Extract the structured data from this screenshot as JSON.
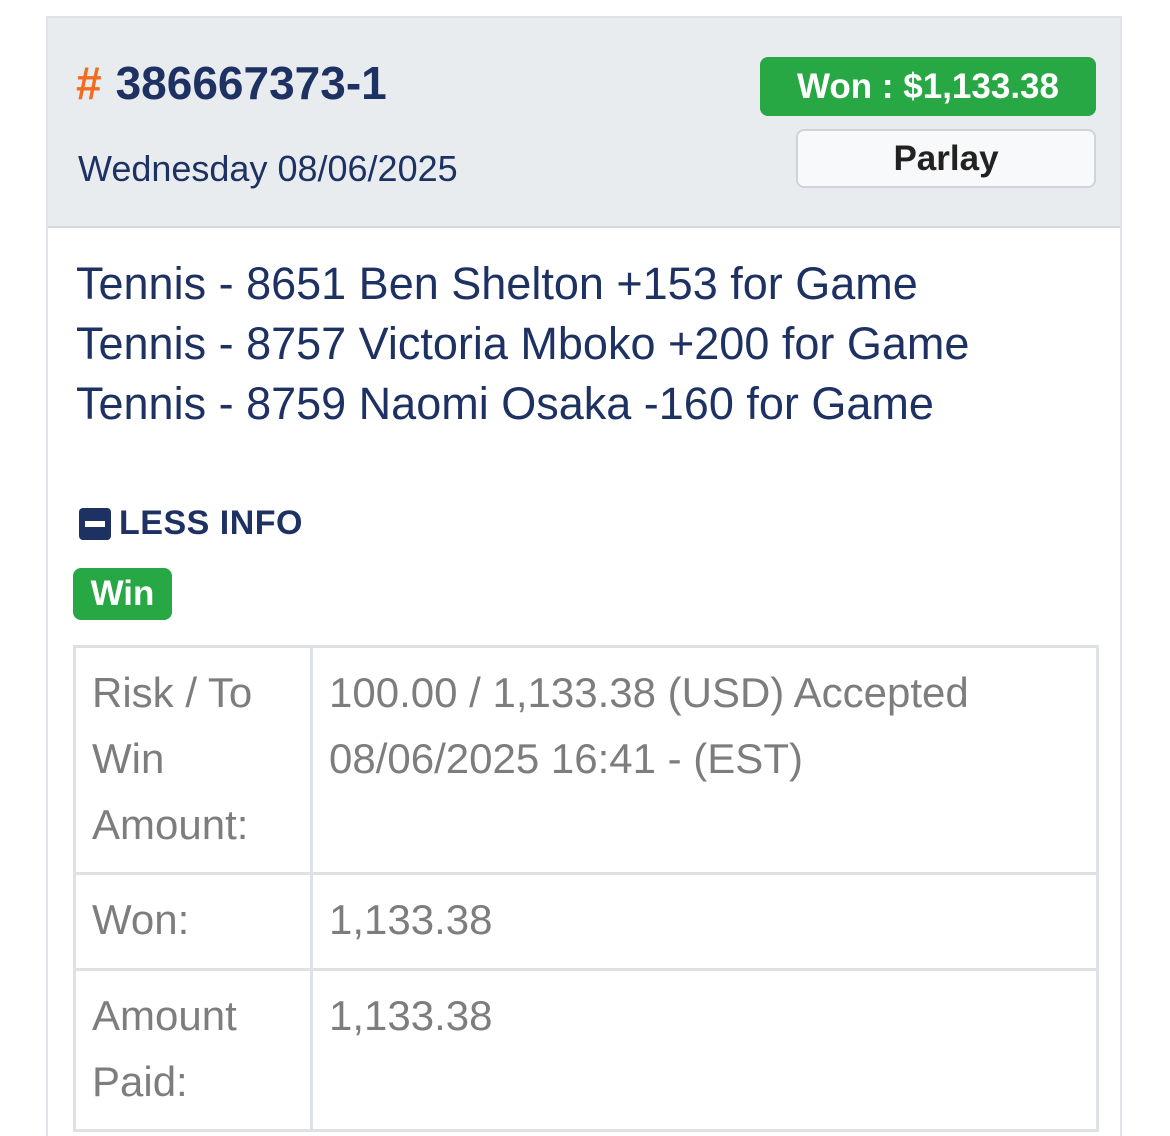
{
  "ticket": {
    "hash_symbol": "#",
    "number": "386667373-1",
    "date": "Wednesday 08/06/2025"
  },
  "status_badge": "Won : $1,133.38",
  "bet_type": "Parlay",
  "selections": [
    "Tennis - 8651 Ben Shelton +153 for Game",
    "Tennis - 8757 Victoria Mboko +200 for Game",
    "Tennis - 8759 Naomi Osaka -160 for Game"
  ],
  "toggle": {
    "label": "LESS INFO",
    "icon": "minus-square-icon"
  },
  "result_badge": "Win",
  "details": {
    "risk_label": "Risk / To Win Amount:",
    "risk_value": "100.00 / 1,133.38 (USD) Accepted 08/06/2025 16:41 - (EST)",
    "won_label": "Won:",
    "won_value": "1,133.38",
    "paid_label": "Amount Paid:",
    "paid_value": "1,133.38"
  },
  "colors": {
    "navy": "#1e3163",
    "orange": "#f26b21",
    "green": "#27a844",
    "header_bg": "#e9ecef",
    "muted_text": "#7d7d7d"
  }
}
